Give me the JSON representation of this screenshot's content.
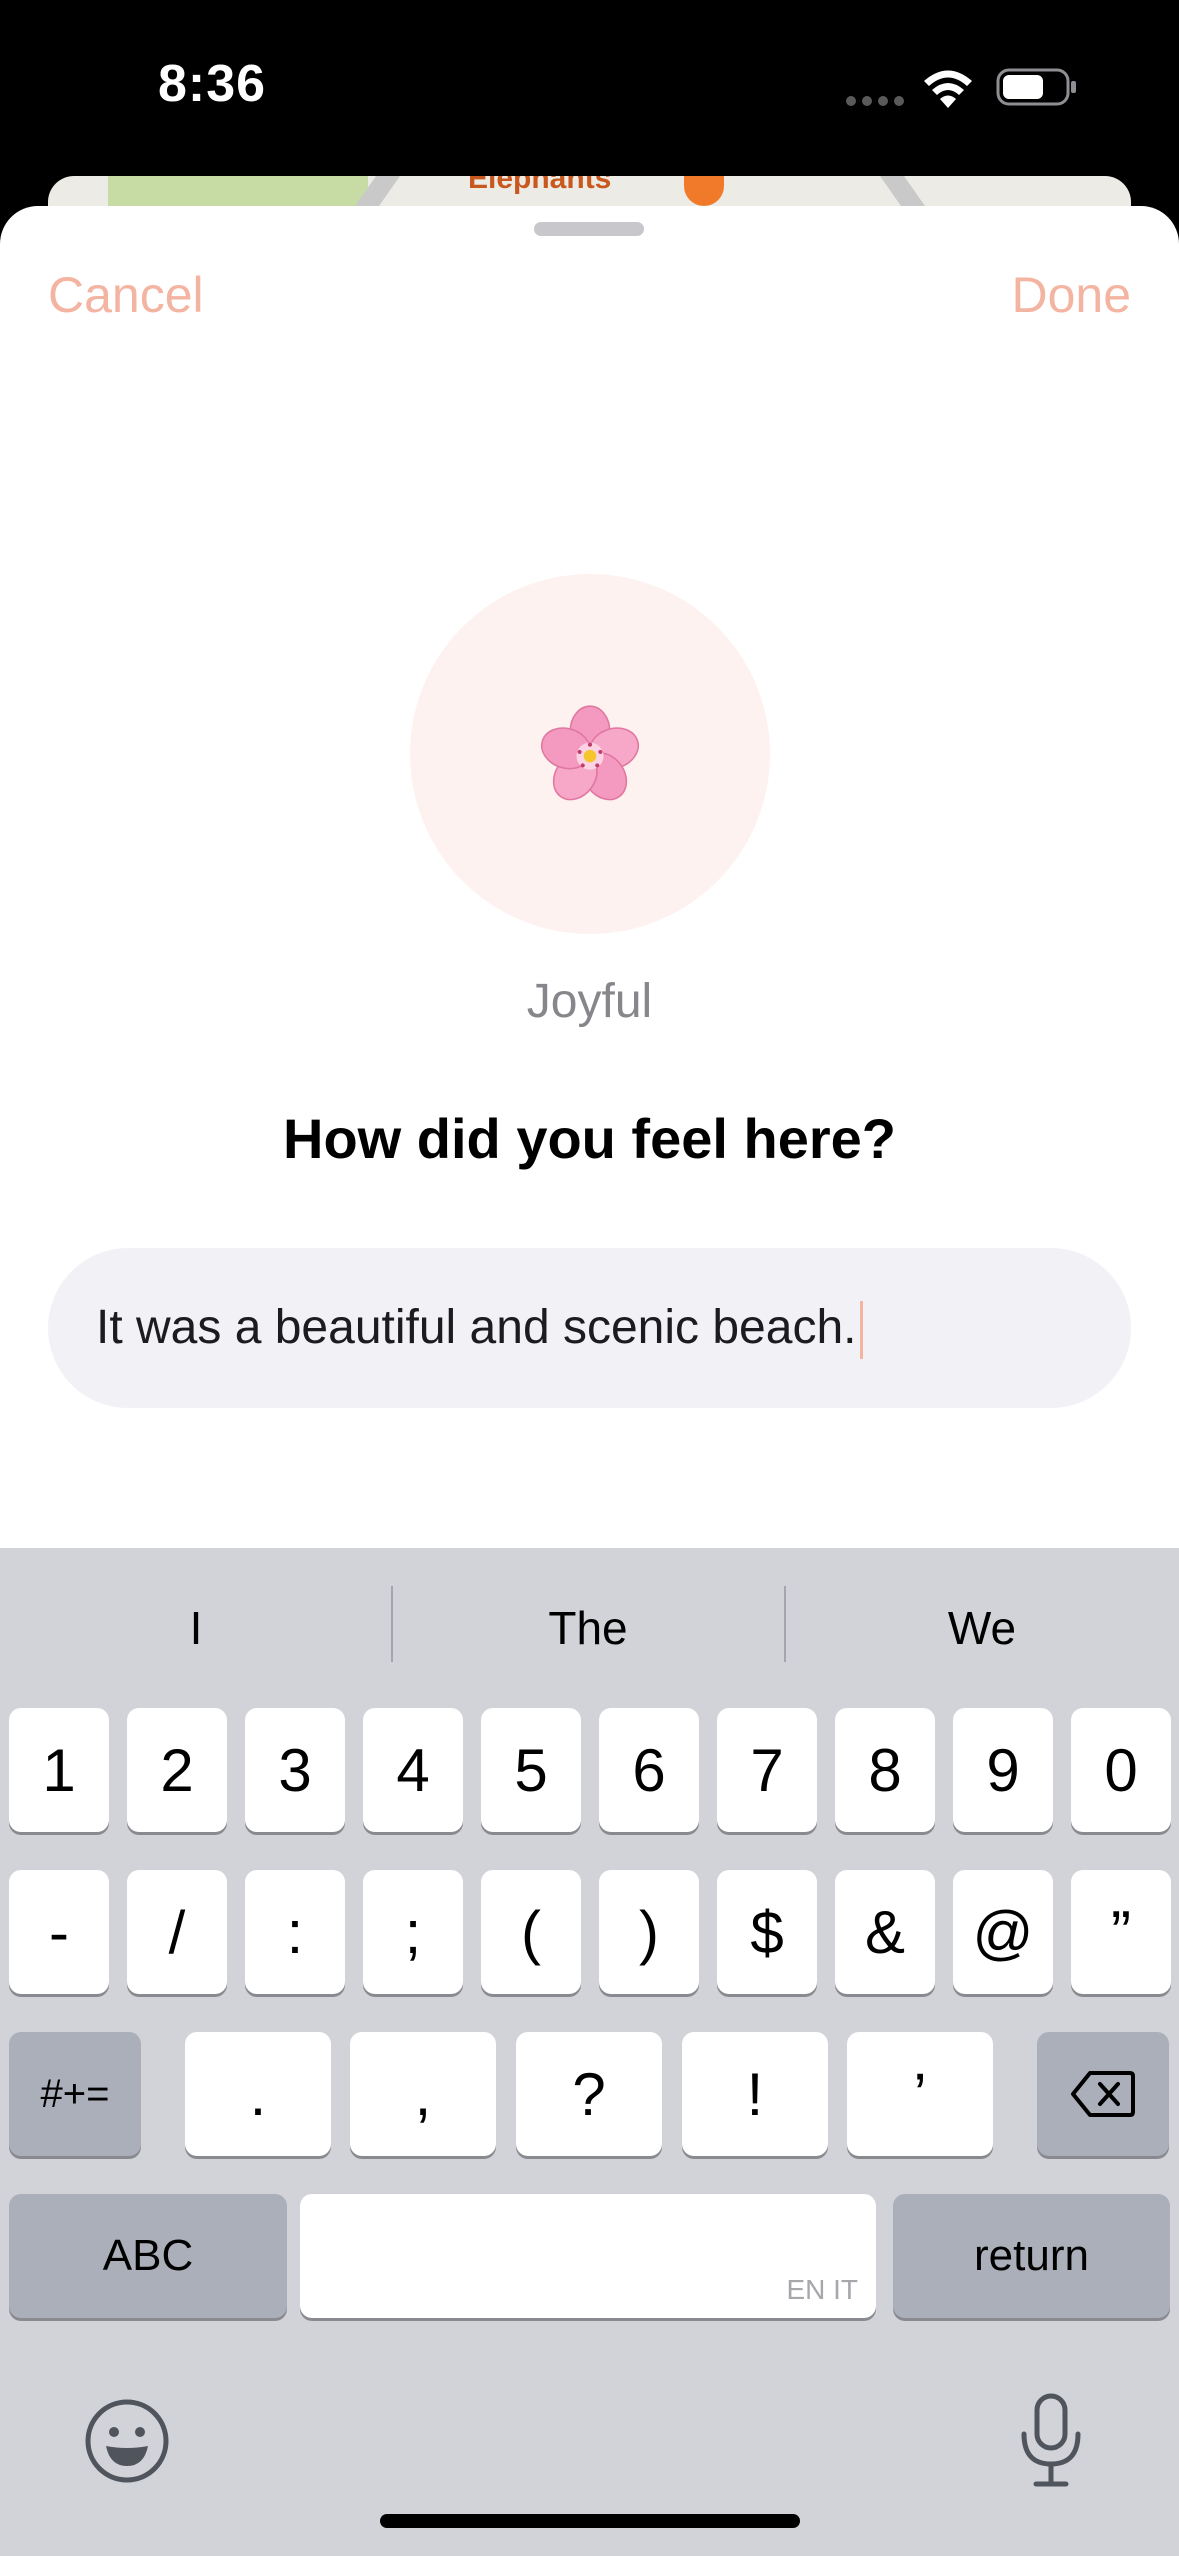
{
  "status": {
    "time": "8:36"
  },
  "map": {
    "peek_label": "Elephants"
  },
  "sheet": {
    "cancel_label": "Cancel",
    "done_label": "Done",
    "mood_label": "Joyful",
    "mood_icon": "cherry-blossom-icon",
    "question": "How did you feel here?",
    "note_value": "It was a beautiful and scenic beach.",
    "accent_color": "#f4b4a2"
  },
  "keyboard": {
    "suggestions": [
      "I",
      "The",
      "We"
    ],
    "row1": [
      "1",
      "2",
      "3",
      "4",
      "5",
      "6",
      "7",
      "8",
      "9",
      "0"
    ],
    "row2": [
      "-",
      "/",
      ":",
      ";",
      "(",
      ")",
      "$",
      "&",
      "@",
      "”"
    ],
    "row3": [
      ".",
      ",",
      "?",
      "!",
      "’"
    ],
    "symbols_label": "#+=",
    "abc_label": "ABC",
    "space_language": "EN IT",
    "return_label": "return"
  }
}
